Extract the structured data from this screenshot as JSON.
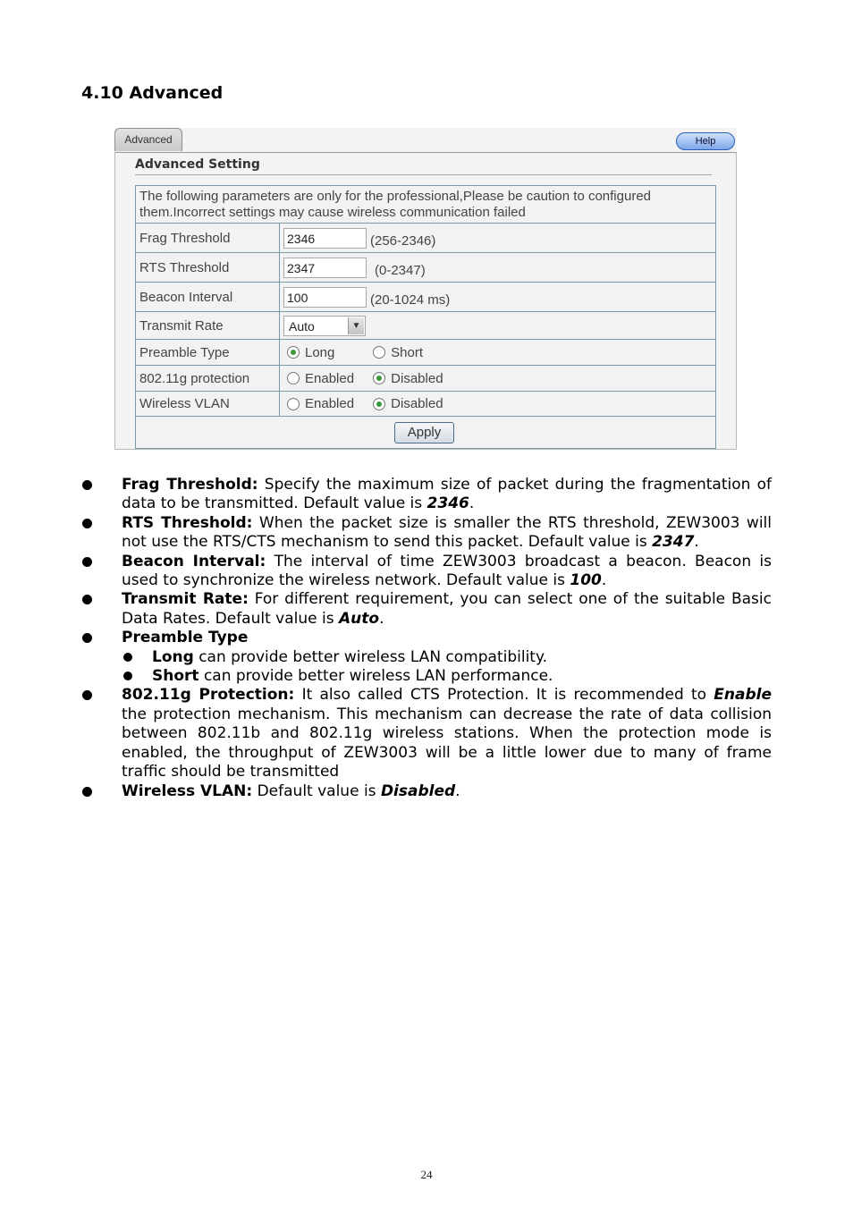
{
  "section_heading": "4.10 Advanced",
  "ui": {
    "tab_label": "Advanced",
    "help_label": "Help",
    "setting_title": "Advanced Setting",
    "note": "The following parameters are only for the professional,Please be caution to configured them.Incorrect settings may cause wireless communication failed",
    "frag": {
      "label": "Frag Threshold",
      "value": "2346",
      "range": "(256-2346)"
    },
    "rts": {
      "label": "RTS Threshold",
      "value": "2347",
      "range": "(0-2347)"
    },
    "beacon": {
      "label": "Beacon Interval",
      "value": "100",
      "range": "(20-1024 ms)"
    },
    "rate": {
      "label": "Transmit Rate",
      "value": "Auto"
    },
    "preamble": {
      "label": "Preamble Type",
      "options": [
        "Long",
        "Short"
      ],
      "selected": "Long"
    },
    "protection": {
      "label": "802.11g protection",
      "options": [
        "Enabled",
        "Disabled"
      ],
      "selected": "Disabled"
    },
    "vlan": {
      "label": "Wireless VLAN",
      "options": [
        "Enabled",
        "Disabled"
      ],
      "selected": "Disabled"
    },
    "apply_label": "Apply"
  },
  "bullets": {
    "frag": {
      "term": "Frag Threshold:",
      "text": " Specify the maximum size of packet during the fragmentation of data to be transmitted. Default value is ",
      "value": "2346",
      "end": "."
    },
    "rts": {
      "term": "RTS Threshold:",
      "text": " When the packet size is smaller the RTS threshold, ZEW3003 will not use the RTS/CTS mechanism to send this packet. Default value is ",
      "value": "2347",
      "end": "."
    },
    "beacon": {
      "term": "Beacon Interval:",
      "text": " The interval of time ZEW3003 broadcast a beacon. Beacon is used to synchronize the wireless network. Default value is ",
      "value": "100",
      "end": "."
    },
    "rate": {
      "term": "Transmit Rate:",
      "text": " For different requirement, you can select one of the suitable Basic Data Rates. Default value is ",
      "value": "Auto",
      "end": "."
    },
    "preamble": {
      "term": "Preamble Type",
      "long": {
        "term": "Long",
        "text": " can provide better wireless LAN compatibility."
      },
      "short": {
        "term": "Short",
        "text": " can provide better wireless LAN performance."
      }
    },
    "protection": {
      "term": "802.11g Protection:",
      "text": " It also called CTS Protection. It is recommended to ",
      "value": "Enable",
      "text2": " the protection mechanism. This mechanism can decrease the rate of data collision between 802.11b and 802.11g wireless stations. When the protection mode is enabled, the throughput of ZEW3003 will be a little lower due to many of frame traffic should be transmitted"
    },
    "vlan": {
      "term": "Wireless VLAN:",
      "text": " Default value is ",
      "value": "Disabled",
      "end": "."
    }
  },
  "page_number": "24"
}
